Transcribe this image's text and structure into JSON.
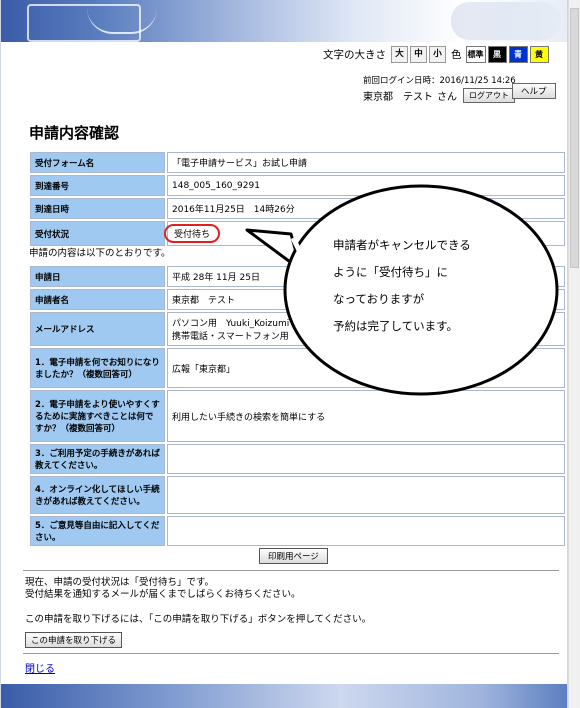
{
  "header": {
    "font_size_label": "文字の大きさ",
    "font_sizes": [
      "大",
      "中",
      "小"
    ],
    "color_label": "色",
    "colors": [
      {
        "label": "標準",
        "bg": "#ffffff"
      },
      {
        "label": "黒",
        "bg": "#000000"
      },
      {
        "label": "青",
        "bg": "#0033cc"
      },
      {
        "label": "黄",
        "bg": "#ffff00"
      }
    ],
    "last_login": "前回ログイン日時：2016/11/25 14:26",
    "user_name": "東京都　テスト",
    "user_suffix": "さん",
    "logout_label": "ログアウト",
    "help_label": "ヘルプ"
  },
  "page_title": "申請内容確認",
  "summary": [
    {
      "label": "受付フォーム名",
      "value": "「電子申請サービス」お試し申請"
    },
    {
      "label": "到達番号",
      "value": "148_005_160_9291"
    },
    {
      "label": "到達日時",
      "value": "2016年11月25日　14時26分"
    },
    {
      "label": "受付状況",
      "value": "受付待ち"
    }
  ],
  "content_note": "申請の内容は以下のとおりです。",
  "details": [
    {
      "label": "申請日",
      "value": "平成 28年 11月 25日"
    },
    {
      "label": "申請者名",
      "value": "東京都　テスト"
    },
    {
      "label": "メールアドレス",
      "value": "パソコン用　Yuuki_Koizumi",
      "value2": "携帯電話・スマートフォン用"
    },
    {
      "label": "1．電子申請を何でお知りになりましたか？（複数回答可）",
      "value": "広報「東京都」"
    },
    {
      "label": "2．電子申請をより使いやすくするために実施すべきことは何ですか？（複数回答可）",
      "value": "利用したい手続きの検索を簡単にする"
    },
    {
      "label": "3．ご利用予定の手続きがあれば教えてください。",
      "value": ""
    },
    {
      "label": "4．オンライン化してほしい手続きがあれば教えてください。",
      "value": ""
    },
    {
      "label": "5．ご意見等自由に記入してください。",
      "value": ""
    }
  ],
  "print_label": "印刷用ページ",
  "status_text_1": "現在、申請の受付状況は「受付待ち」です。",
  "status_text_2": "受付結果を通知するメールが届くまでしばらくお待ちください。",
  "withdraw_text": "この申請を取り下げるには、「この申請を取り下げる」ボタンを押してください。",
  "withdraw_label": "この申請を取り下げる",
  "close_label": "閉じる",
  "callout": {
    "line1": "申請者がキャンセルできる",
    "line2": "ように「受付待ち」に",
    "line3": "なっておりますが",
    "line4": "予約は完了しています。"
  }
}
